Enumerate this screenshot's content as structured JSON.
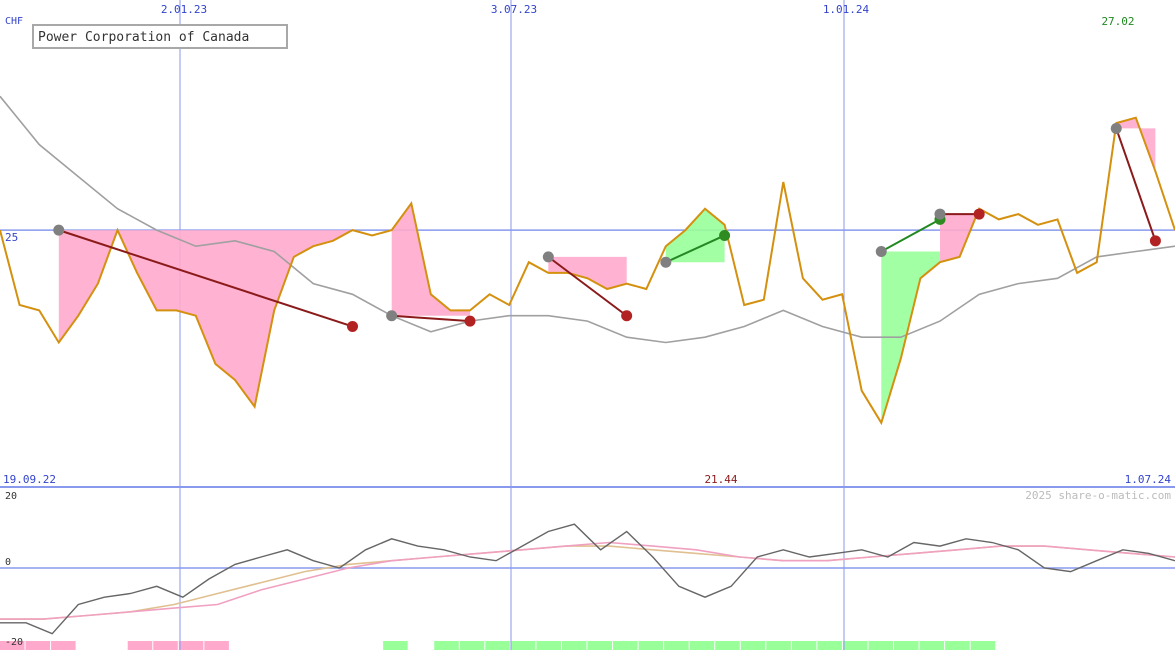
{
  "title": "Power Corporation of Canada",
  "currency": "CHF",
  "date_labels": {
    "d1": "2.01.23",
    "d2": "3.07.23",
    "d3": "1.01.24"
  },
  "last_date": "27.02",
  "start_date": "19.09.22",
  "end_date": "1.07.24",
  "price_level_label": "25",
  "min_price_label": "21.44",
  "copyright": "2025 share-o-matic.com",
  "osc_labels": {
    "top": "20",
    "zero": "0",
    "bottom": "-20"
  },
  "colors": {
    "price": "#d4900f",
    "benchmark": "#a0a0a0",
    "grid": "#8899ee",
    "axis_text": "#3344cc",
    "gain_fill": "#99ff99",
    "loss_fill": "#ffaacc",
    "buy_line": "#228822",
    "sell_line": "#8b1a1a",
    "marker_entry": "#808080",
    "marker_loss": "#b22222",
    "marker_gain": "#2e8b22",
    "osc_main": "#666666",
    "osc_fast": "#f0a0c0",
    "osc_slow": "#e0c090"
  },
  "chart_data": {
    "type": "line",
    "title": "Power Corporation of Canada",
    "xlabel": "",
    "ylabel": "CHF",
    "y_reference_lines": [
      25
    ],
    "y_min_label": 21.44,
    "series": [
      {
        "values": [
          25.0,
          23.6,
          23.5,
          22.9,
          23.4,
          24.0,
          25.0,
          24.2,
          23.5,
          23.5,
          23.4,
          22.5,
          22.2,
          21.7,
          23.5,
          24.5,
          24.7,
          24.8,
          25.0,
          24.9,
          25.0,
          25.5,
          23.8,
          23.5,
          23.5,
          23.8,
          23.6,
          24.4,
          24.2,
          24.2,
          24.1,
          23.9,
          24.0,
          23.9,
          24.7,
          25.0,
          25.4,
          25.1,
          23.6,
          23.7,
          25.9,
          24.1,
          23.7,
          23.8,
          22.0,
          21.4,
          22.6,
          24.1,
          24.4,
          24.5,
          25.4,
          25.2,
          25.3,
          25.1,
          25.2,
          24.2,
          24.4,
          27.0,
          27.1,
          26.1,
          25.0
        ]
      },
      {
        "values": [
          27.5,
          26.6,
          26.0,
          25.4,
          25.0,
          24.7,
          24.8,
          24.6,
          24.0,
          23.8,
          23.4,
          23.1,
          23.3,
          23.4,
          23.4,
          23.3,
          23.0,
          22.9,
          23.0,
          23.2,
          23.5,
          23.2,
          23.0,
          23.0,
          23.3,
          23.8,
          24.0,
          24.1,
          24.5,
          24.6,
          24.7
        ]
      }
    ],
    "oscillator": {
      "ylim": [
        -20,
        20
      ],
      "tick_labels": [
        "20",
        "0",
        "-20"
      ],
      "main": [
        -15,
        -15,
        -18,
        -10,
        -8,
        -7,
        -5,
        -8,
        -3,
        1,
        3,
        5,
        2,
        0,
        5,
        8,
        6,
        5,
        3,
        2,
        6,
        10,
        12,
        5,
        10,
        3,
        -5,
        -8,
        -5,
        3,
        5,
        3,
        4,
        5,
        3,
        7,
        6,
        8,
        7,
        5,
        0,
        -1,
        2,
        5,
        4,
        2
      ],
      "fast": [
        -14,
        -14,
        -13,
        -12,
        -11,
        -10,
        -6,
        -3,
        0,
        2,
        3,
        4,
        5,
        6,
        7,
        6,
        5,
        3,
        2,
        2,
        3,
        4,
        5,
        6,
        6,
        5,
        4,
        3
      ],
      "slow": [
        -14,
        -14,
        -13,
        -12,
        -10,
        -7,
        -4,
        -1,
        1,
        2,
        3,
        4,
        5,
        6,
        6,
        5,
        4,
        3,
        2,
        2,
        3,
        4,
        5,
        6,
        6,
        5,
        4,
        3
      ]
    },
    "volume": [
      -1,
      -1,
      -1,
      0,
      0,
      -1,
      -1,
      -1,
      -1,
      0,
      0,
      0,
      0,
      0,
      0,
      1,
      0,
      1,
      1,
      1,
      1,
      1,
      1,
      1,
      1,
      1,
      1,
      1,
      1,
      1,
      1,
      1,
      1,
      1,
      1,
      1,
      1,
      1,
      1,
      0,
      0,
      0,
      0,
      0,
      0,
      0
    ],
    "trades": [
      {
        "entry_date": "",
        "entry": 25.0,
        "exit": 23.2,
        "result": "loss"
      },
      {
        "entry_date": "",
        "entry": 23.4,
        "exit": 23.3,
        "result": "loss"
      },
      {
        "entry_date": "",
        "entry": 24.5,
        "exit": 23.4,
        "result": "loss"
      },
      {
        "entry_date": "",
        "entry": 24.4,
        "exit": 24.9,
        "result": "gain"
      },
      {
        "entry_date": "",
        "entry": 24.6,
        "exit": 25.2,
        "result": "gain"
      },
      {
        "entry_date": "",
        "entry": 25.3,
        "exit": 25.3,
        "result": "loss"
      },
      {
        "entry_date": "",
        "entry": 26.9,
        "exit": 24.8,
        "result": "loss"
      }
    ]
  }
}
